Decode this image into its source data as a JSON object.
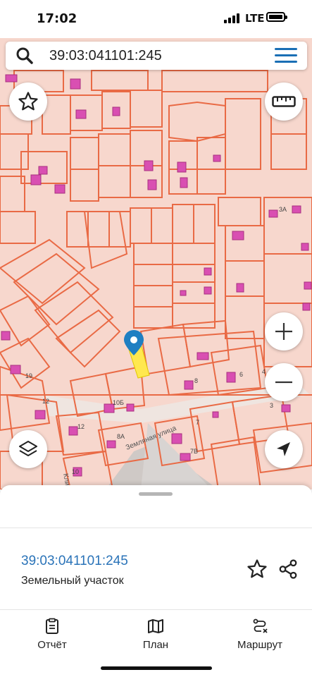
{
  "status": {
    "time": "17:02",
    "network": "LTE"
  },
  "search": {
    "query": "39:03:041101:245"
  },
  "map": {
    "street_labels": [
      "Земляная улица",
      "Клинич"
    ],
    "house_numbers": [
      "19",
      "12",
      "10Б",
      "8А",
      "12",
      "8",
      "6",
      "10",
      "7",
      "7В",
      "3",
      "4",
      "3А"
    ],
    "parcel_color": "#ffe84f",
    "line_color": "#e96a45",
    "building_color": "#d94fb2"
  },
  "sheet": {
    "parcel_number": "39:03:041101:245",
    "parcel_type": "Земельный участок"
  },
  "tabs": [
    {
      "label": "Отчёт",
      "icon": "report-icon"
    },
    {
      "label": "План",
      "icon": "map-plan-icon"
    },
    {
      "label": "Маршрут",
      "icon": "route-icon"
    }
  ],
  "colors": {
    "accent": "#2a73b8",
    "map_background": "#f7d7cd"
  }
}
